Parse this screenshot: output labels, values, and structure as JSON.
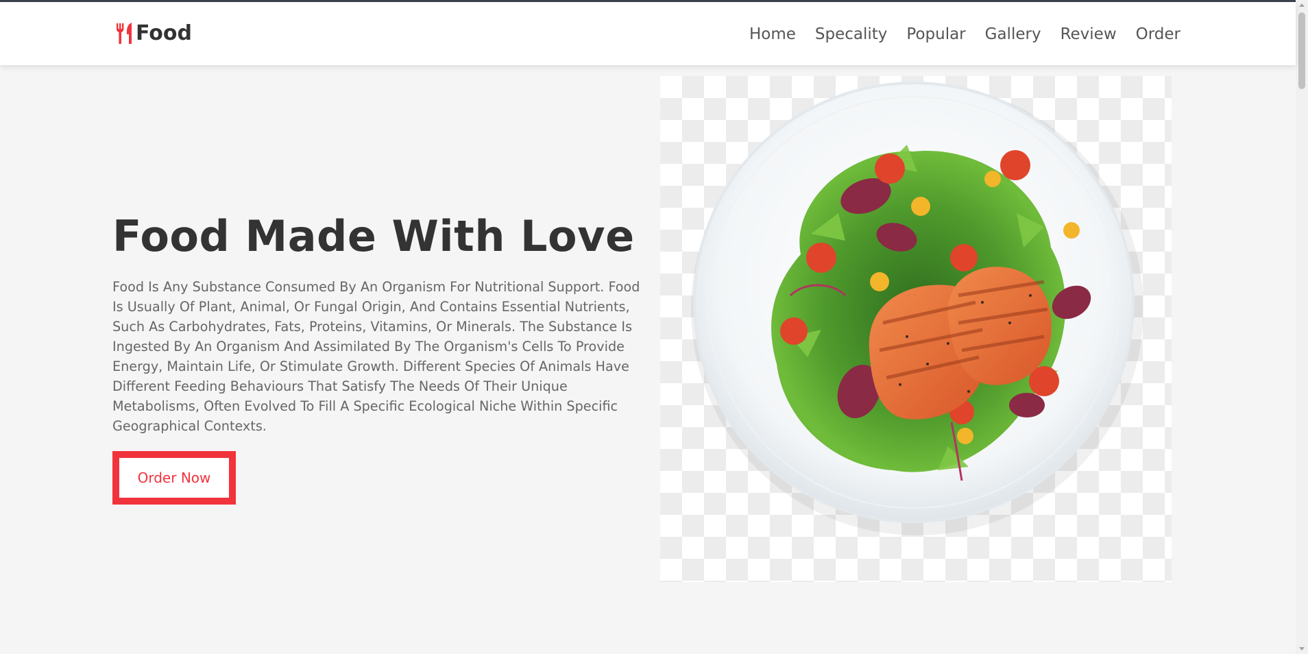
{
  "header": {
    "logo_text": "Food",
    "nav": [
      "Home",
      "Specality",
      "Popular",
      "Gallery",
      "Review",
      "Order"
    ]
  },
  "hero": {
    "title": "Food Made With Love",
    "description": "Food Is Any Substance Consumed By An Organism For Nutritional Support. Food Is Usually Of Plant, Animal, Or Fungal Origin, And Contains Essential Nutrients, Such As Carbohydrates, Fats, Proteins, Vitamins, Or Minerals. The Substance Is Ingested By An Organism And Assimilated By The Organism's Cells To Provide Energy, Maintain Life, Or Stimulate Growth. Different Species Of Animals Have Different Feeding Behaviours That Satisfy The Needs Of Their Unique Metabolisms, Often Evolved To Fill A Specific Ecological Niche Within Specific Geographical Contexts.",
    "button_label": "Order Now",
    "image": "salmon-salad-plate"
  },
  "colors": {
    "accent": "#f1333c",
    "heading": "#333333",
    "body_text": "#666666",
    "background": "#f5f5f5"
  },
  "icons": {
    "logo": "utensils-icon"
  }
}
